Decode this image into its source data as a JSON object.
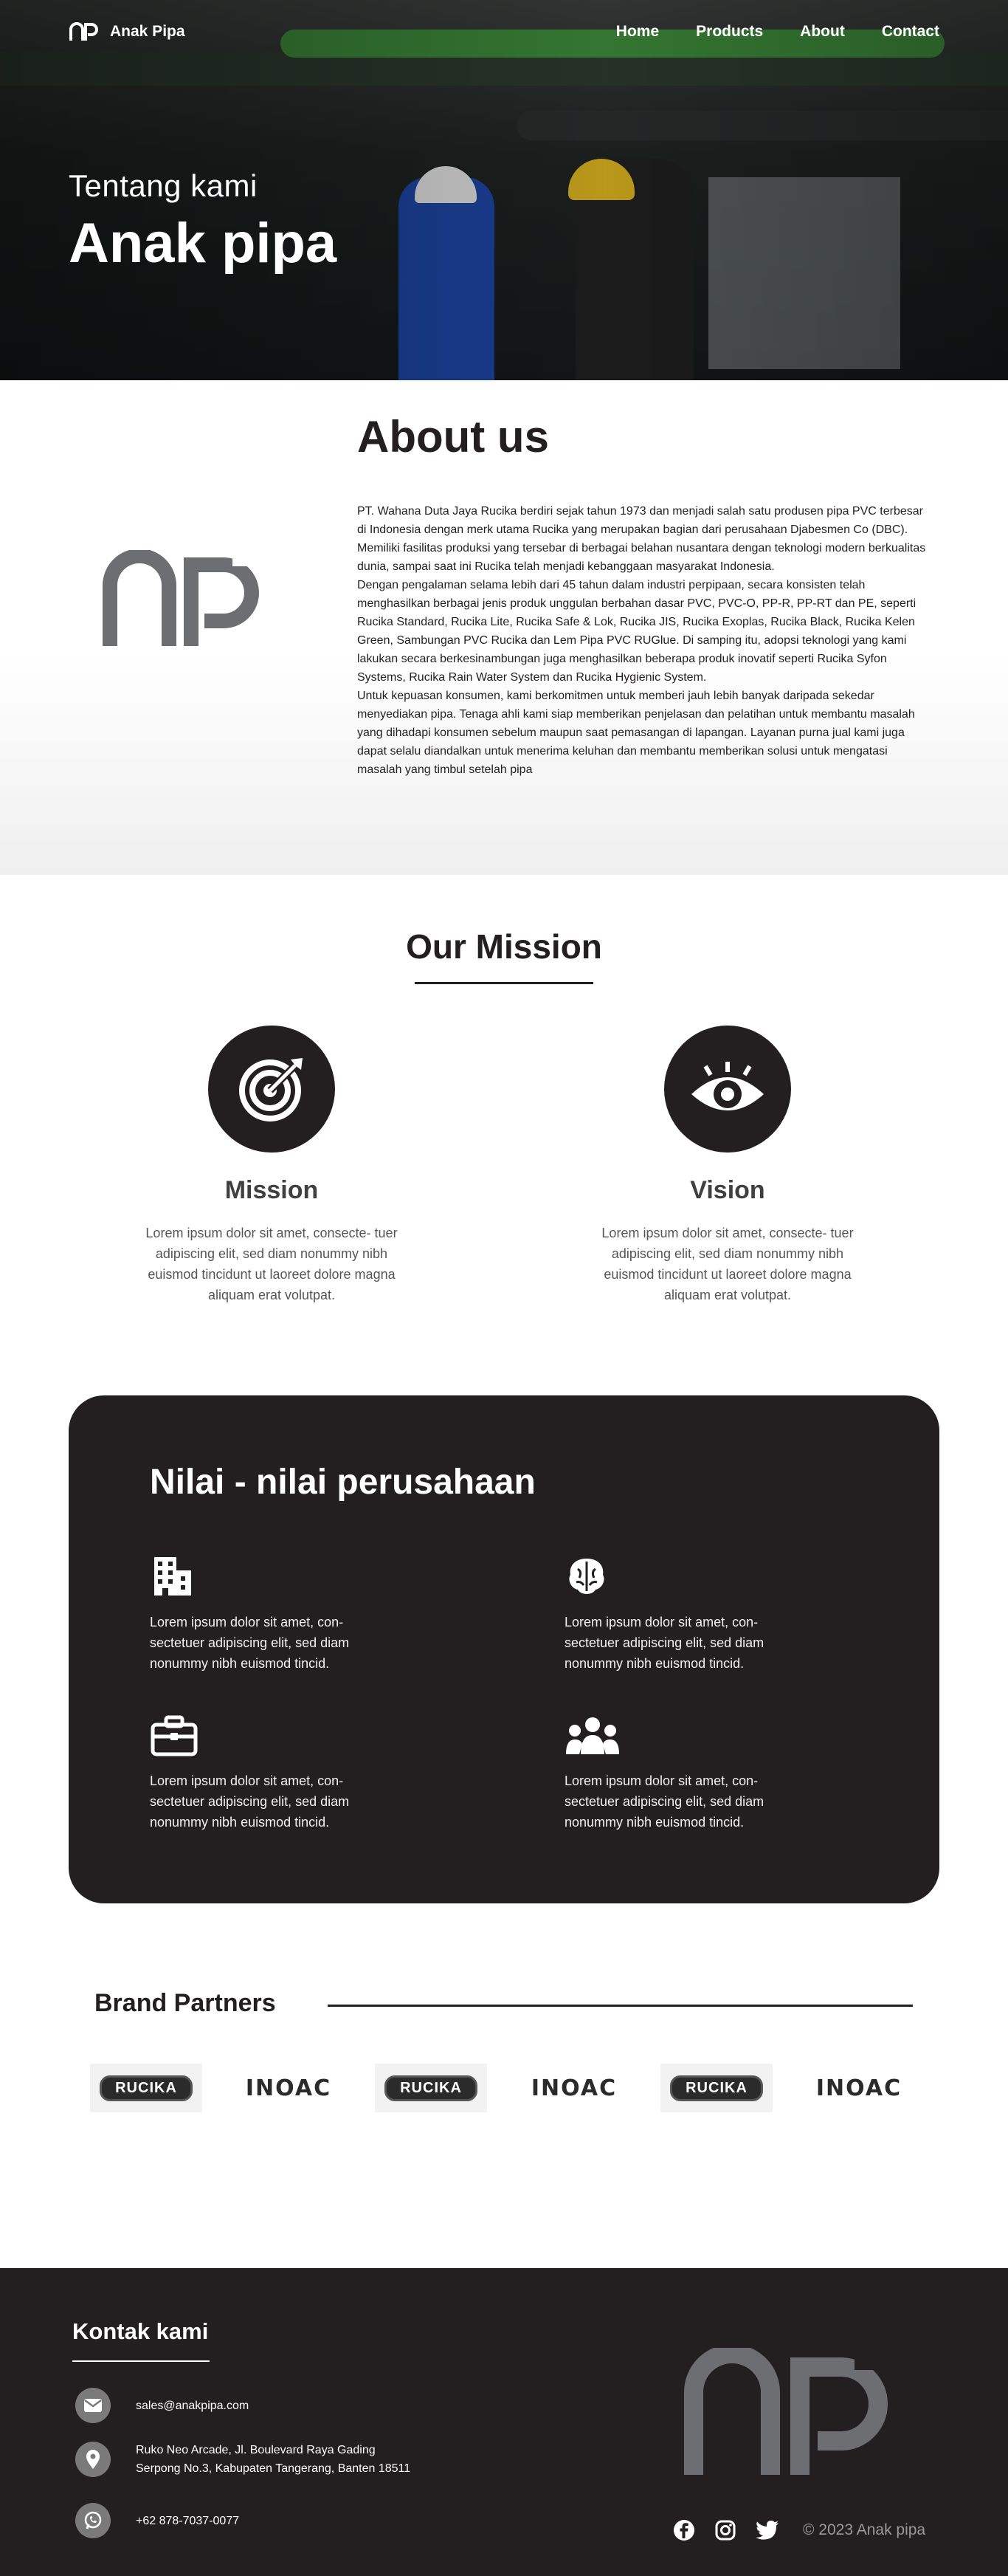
{
  "nav": {
    "brand": "Anak Pipa",
    "links": [
      "Home",
      "Products",
      "About",
      "Contact"
    ]
  },
  "hero": {
    "subtitle": "Tentang kami",
    "title": "Anak pipa"
  },
  "about": {
    "heading": "About us",
    "paragraphs": [
      "PT. Wahana Duta Jaya Rucika berdiri sejak tahun 1973 dan menjadi salah satu produsen pipa PVC terbesar di Indonesia dengan merk utama Rucika yang merupakan bagian dari perusahaan Djabesmen Co (DBC). Memiliki fasilitas produksi yang tersebar di berbagai belahan nusantara dengan teknologi modern berkualitas dunia, sampai saat ini Rucika telah menjadi kebanggaan masyarakat Indonesia.",
      "Dengan pengalaman selama lebih dari 45 tahun dalam industri perpipaan, secara konsisten telah menghasilkan berbagai jenis produk unggulan berbahan dasar PVC, PVC-O, PP-R, PP-RT dan PE, seperti Rucika Standard, Rucika Lite, Rucika Safe & Lok, Rucika JIS, Rucika Exoplas, Rucika Black, Rucika Kelen Green, Sambungan PVC Rucika dan Lem Pipa PVC RUGlue. Di samping itu, adopsi teknologi yang kami lakukan secara berkesinambungan juga menghasilkan beberapa produk inovatif seperti Rucika Syfon Systems, Rucika Rain Water System dan Rucika Hygienic System.",
      "Untuk kepuasan konsumen, kami berkomitmen untuk memberi jauh lebih banyak daripada sekedar menyediakan pipa. Tenaga ahli kami siap memberikan penjelasan dan pelatihan untuk membantu masalah yang dihadapi konsumen sebelum maupun saat pemasangan di lapangan. Layanan purna jual kami juga dapat selalu diandalkan untuk menerima keluhan dan membantu memberikan solusi untuk mengatasi masalah yang timbul setelah pipa"
    ]
  },
  "mission": {
    "heading": "Our Mission",
    "cards": [
      {
        "title": "Mission",
        "text": "Lorem ipsum dolor sit amet, consecte- tuer adipiscing elit, sed diam nonummy nibh euismod tincidunt ut laoreet dolore magna aliquam erat volutpat.",
        "icon": "target-icon"
      },
      {
        "title": "Vision",
        "text": "Lorem ipsum dolor sit amet, consecte- tuer adipiscing elit, sed diam nonummy nibh euismod tincidunt ut laoreet dolore magna aliquam erat volutpat.",
        "icon": "eye-icon"
      }
    ]
  },
  "values": {
    "heading": "Nilai - nilai perusahaan",
    "items": [
      {
        "icon": "building-icon",
        "text": "Lorem ipsum dolor sit amet, con- sectetuer adipiscing elit, sed diam nonummy nibh euismod tincid."
      },
      {
        "icon": "brain-icon",
        "text": "Lorem ipsum dolor sit amet, con- sectetuer adipiscing elit, sed diam nonummy nibh euismod tincid."
      },
      {
        "icon": "briefcase-icon",
        "text": "Lorem ipsum dolor sit amet, con- sectetuer adipiscing elit, sed diam nonummy nibh euismod tincid."
      },
      {
        "icon": "team-icon",
        "text": "Lorem ipsum dolor sit amet, con- sectetuer adipiscing elit, sed diam nonummy nibh euismod tincid."
      }
    ]
  },
  "partners": {
    "heading": "Brand Partners",
    "logos": [
      "RUCIKA",
      "INOAC",
      "RUCIKA",
      "INOAC",
      "RUCIKA",
      "INOAC"
    ]
  },
  "footer": {
    "heading": "Kontak kami",
    "email": "sales@anakpipa.com",
    "address_line1": "Ruko Neo Arcade, Jl. Boulevard Raya Gading",
    "address_line2": "Serpong No.3, Kabupaten Tangerang, Banten 18511",
    "phone": "+62 878-7037-0077",
    "copyright": "© 2023 Anak pipa"
  },
  "colors": {
    "dark": "#231f20",
    "gray_logo": "#6d6e71",
    "icon_circle": "#7a7a7a"
  }
}
